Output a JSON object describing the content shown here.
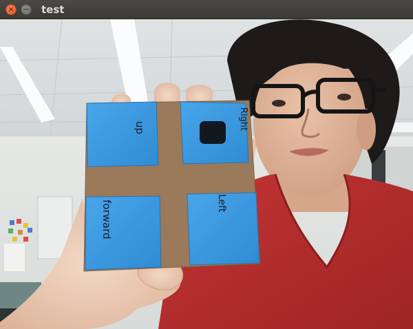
{
  "window": {
    "title": "test",
    "close_glyph": "×",
    "minimize_glyph": "−"
  },
  "camera_feed": {
    "card": {
      "quadrants": [
        {
          "position": "top-left",
          "text": "up"
        },
        {
          "position": "top-right",
          "text": "Right"
        },
        {
          "position": "bottom-left",
          "text": "forward"
        },
        {
          "position": "bottom-right",
          "text": "Left"
        }
      ],
      "background_color": "#9a7a5a",
      "quadrant_color": "#3d9be0"
    },
    "person": {
      "shirt_color": "#b52a2a"
    }
  }
}
